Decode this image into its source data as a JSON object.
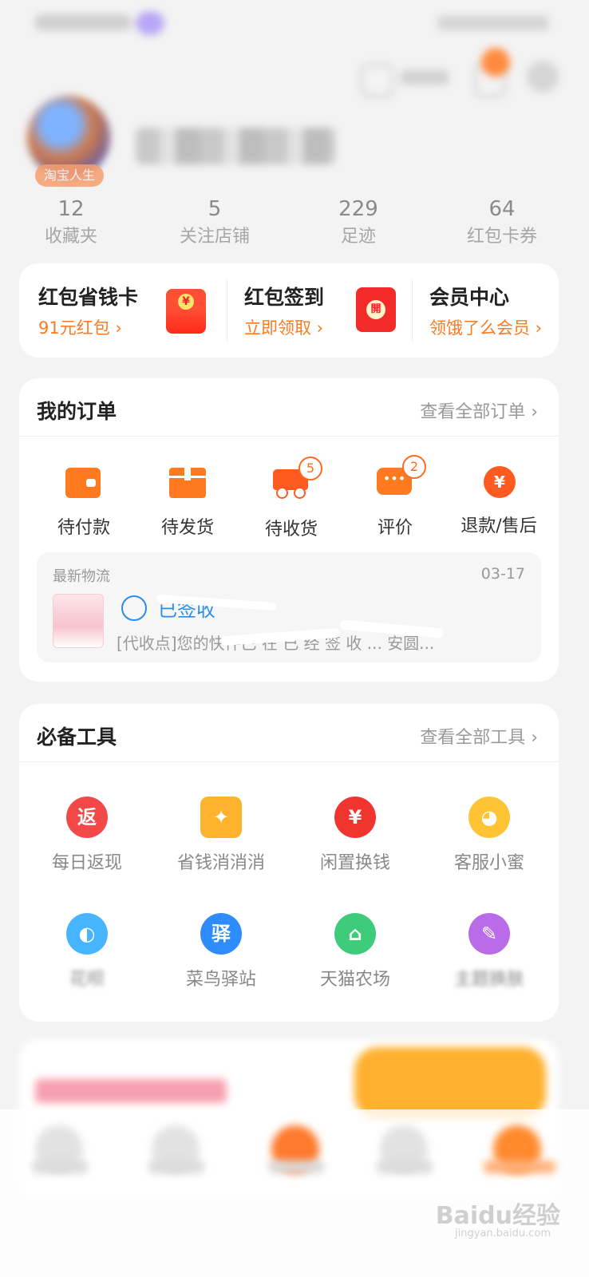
{
  "profile": {
    "badge": "淘宝人生"
  },
  "stats": [
    {
      "value": "12",
      "label": "收藏夹"
    },
    {
      "value": "5",
      "label": "关注店铺"
    },
    {
      "value": "229",
      "label": "足迹"
    },
    {
      "value": "64",
      "label": "红包卡券"
    }
  ],
  "promo": [
    {
      "title": "红包省钱卡",
      "subtitle": "91元红包 ›",
      "icon": "red-envelope-icon"
    },
    {
      "title": "红包签到",
      "subtitle": "立即领取 ›",
      "icon": "red-packet-open-icon"
    },
    {
      "title": "会员中心",
      "subtitle": "领饿了么会员 ›"
    }
  ],
  "orders": {
    "title": "我的订单",
    "link": "查看全部订单 ›",
    "items": [
      {
        "label": "待付款",
        "icon": "wallet-icon"
      },
      {
        "label": "待发货",
        "icon": "package-icon"
      },
      {
        "label": "待收货",
        "icon": "truck-icon",
        "badge": "5"
      },
      {
        "label": "评价",
        "icon": "comment-icon",
        "badge": "2"
      },
      {
        "label": "退款/售后",
        "icon": "refund-icon"
      }
    ],
    "logistics": {
      "title": "最新物流",
      "date": "03-17",
      "status": "已签收",
      "desc": "[代收点]您的快件已 在 已 经 签 收 ... 安圆..."
    }
  },
  "tools": {
    "title": "必备工具",
    "link": "查看全部工具 ›",
    "items": [
      {
        "label": "每日返现",
        "icon": "cashback-icon",
        "glyph": "返",
        "color": "#f24848"
      },
      {
        "label": "省钱消消消",
        "icon": "gift-icon",
        "glyph": "🎁",
        "color": "#ffb22e"
      },
      {
        "label": "闲置换钱",
        "icon": "money-bag-icon",
        "glyph": "¥",
        "color": "#f0352e"
      },
      {
        "label": "客服小蜜",
        "icon": "service-bot-icon",
        "glyph": "◕",
        "color": "#ffc433"
      },
      {
        "label": "花呗",
        "icon": "huabei-icon",
        "glyph": "◐",
        "color": "#47b4ff"
      },
      {
        "label": "菜鸟驿站",
        "icon": "cainiao-icon",
        "glyph": "驿",
        "color": "#2f8cff"
      },
      {
        "label": "天猫农场",
        "icon": "farm-icon",
        "glyph": "⌂",
        "color": "#3fcc7a"
      },
      {
        "label": "主题换肤",
        "icon": "palette-icon",
        "glyph": "✎",
        "color": "#b96be8"
      }
    ]
  },
  "watermark": {
    "brand": "Baidu经验",
    "url": "jingyan.baidu.com"
  }
}
